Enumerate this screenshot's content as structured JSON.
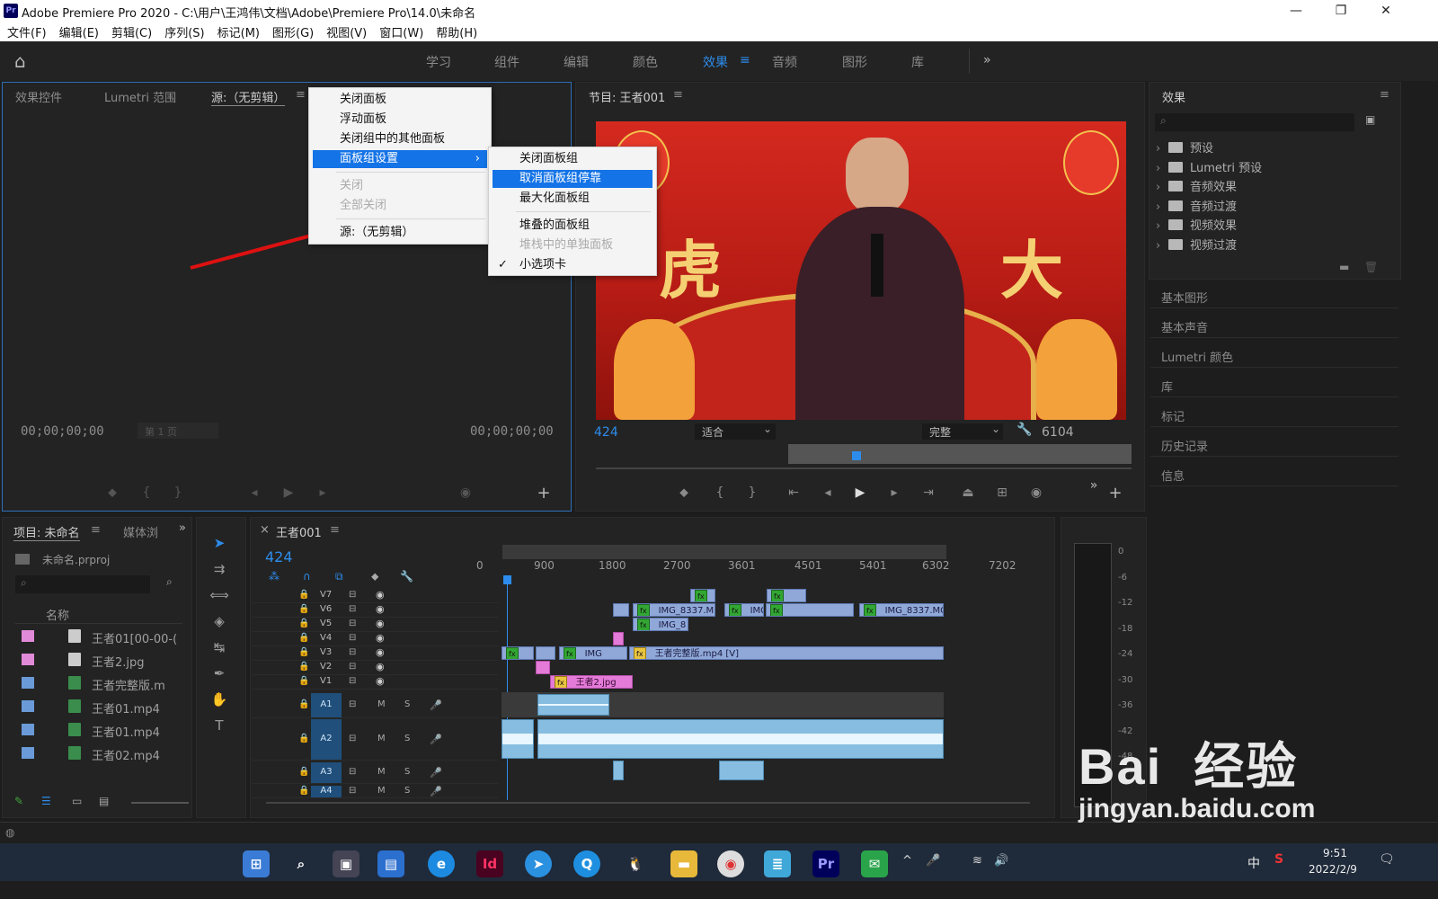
{
  "window": {
    "title": "Adobe Premiere Pro 2020 - C:\\用户\\王鸿伟\\文档\\Adobe\\Premiere Pro\\14.0\\未命名",
    "app_icon": "Pr",
    "controls": [
      "—",
      "❐",
      "✕"
    ]
  },
  "menubar": [
    "文件(F)",
    "编辑(E)",
    "剪辑(C)",
    "序列(S)",
    "标记(M)",
    "图形(G)",
    "视图(V)",
    "窗口(W)",
    "帮助(H)"
  ],
  "workspaces": [
    "学习",
    "组件",
    "编辑",
    "颜色",
    "效果",
    "音频",
    "图形",
    "库"
  ],
  "active_workspace": "效果",
  "source_panel": {
    "tabs": [
      "效果控件",
      "Lumetri 范围",
      "源:（无剪辑）"
    ],
    "timecode_left": "00;00;00;00",
    "timecode_right": "00;00;00;00",
    "page": "第 1 页"
  },
  "context_menu": {
    "items": [
      {
        "label": "关闭面板",
        "state": "normal"
      },
      {
        "label": "浮动面板",
        "state": "normal"
      },
      {
        "label": "关闭组中的其他面板",
        "state": "normal"
      },
      {
        "label": "面板组设置",
        "state": "selected",
        "arrow": "›"
      },
      {
        "label": "关闭",
        "state": "disabled"
      },
      {
        "label": "全部关闭",
        "state": "disabled"
      },
      {
        "label": "源:（无剪辑）",
        "state": "normal"
      }
    ]
  },
  "submenu": {
    "items": [
      {
        "label": "关闭面板组",
        "state": "normal"
      },
      {
        "label": "取消面板组停靠",
        "state": "selected"
      },
      {
        "label": "最大化面板组",
        "state": "normal"
      },
      {
        "label": "堆叠的面板组",
        "state": "normal"
      },
      {
        "label": "堆栈中的单独面板",
        "state": "disabled"
      },
      {
        "label": "小选项卡",
        "state": "checked",
        "check": "✓"
      }
    ]
  },
  "program_monitor": {
    "title": "节目: 王者001",
    "frame": "424",
    "fit": "适合",
    "quality": "完整",
    "duration": "6104",
    "video_text": "虎年大吉"
  },
  "effects_panel": {
    "title": "效果",
    "tree": [
      "预设",
      "Lumetri 预设",
      "音频效果",
      "音频过渡",
      "视频效果",
      "视频过渡"
    ],
    "side_panels": [
      "基本图形",
      "基本声音",
      "Lumetri 颜色",
      "库",
      "标记",
      "历史记录",
      "信息"
    ]
  },
  "project_panel": {
    "tabs": [
      "项目: 未命名",
      "媒体浏"
    ],
    "project_file": "未命名.prproj",
    "column_name": "名称",
    "items": [
      {
        "name": "王者01[00-00-(",
        "color": "#e08ad8",
        "type": "img"
      },
      {
        "name": "王者2.jpg",
        "color": "#e08ad8",
        "type": "img"
      },
      {
        "name": "王者完整版.m",
        "color": "#6a9bd8",
        "type": "vid"
      },
      {
        "name": "王者01.mp4",
        "color": "#6a9bd8",
        "type": "vid"
      },
      {
        "name": "王者01.mp4",
        "color": "#6a9bd8",
        "type": "vid"
      },
      {
        "name": "王者02.mp4",
        "color": "#6a9bd8",
        "type": "vid"
      }
    ]
  },
  "timeline": {
    "title": "王者001",
    "frame": "424",
    "ruler": [
      "0",
      "900",
      "1800",
      "2700",
      "3601",
      "4501",
      "5401",
      "6302",
      "7202"
    ],
    "video_tracks": [
      "V7",
      "V6",
      "V5",
      "V4",
      "V3",
      "V2",
      "V1"
    ],
    "audio_tracks": [
      "A1",
      "A2",
      "A3",
      "A4"
    ],
    "clip_labels": {
      "v6a": "IMG_8337.M",
      "v6b": "IMG",
      "v6c": "IMG_8337.MO",
      "v5": "IMG_8",
      "v3a": "IMG",
      "v3b": "王者完整版.mp4 [V]",
      "v1": "王者2.jpg"
    },
    "fx": "fx",
    "mute": "M",
    "solo": "S"
  },
  "meter_scale": [
    "0",
    "-6",
    "-12",
    "-18",
    "-24",
    "-30",
    "-36",
    "-42",
    "-48"
  ],
  "taskbar": {
    "time": "9:51",
    "date": "2022/2/9",
    "lang": "中"
  },
  "watermark": {
    "brand": "Bai  经验",
    "url": "jingyan.baidu.com"
  }
}
